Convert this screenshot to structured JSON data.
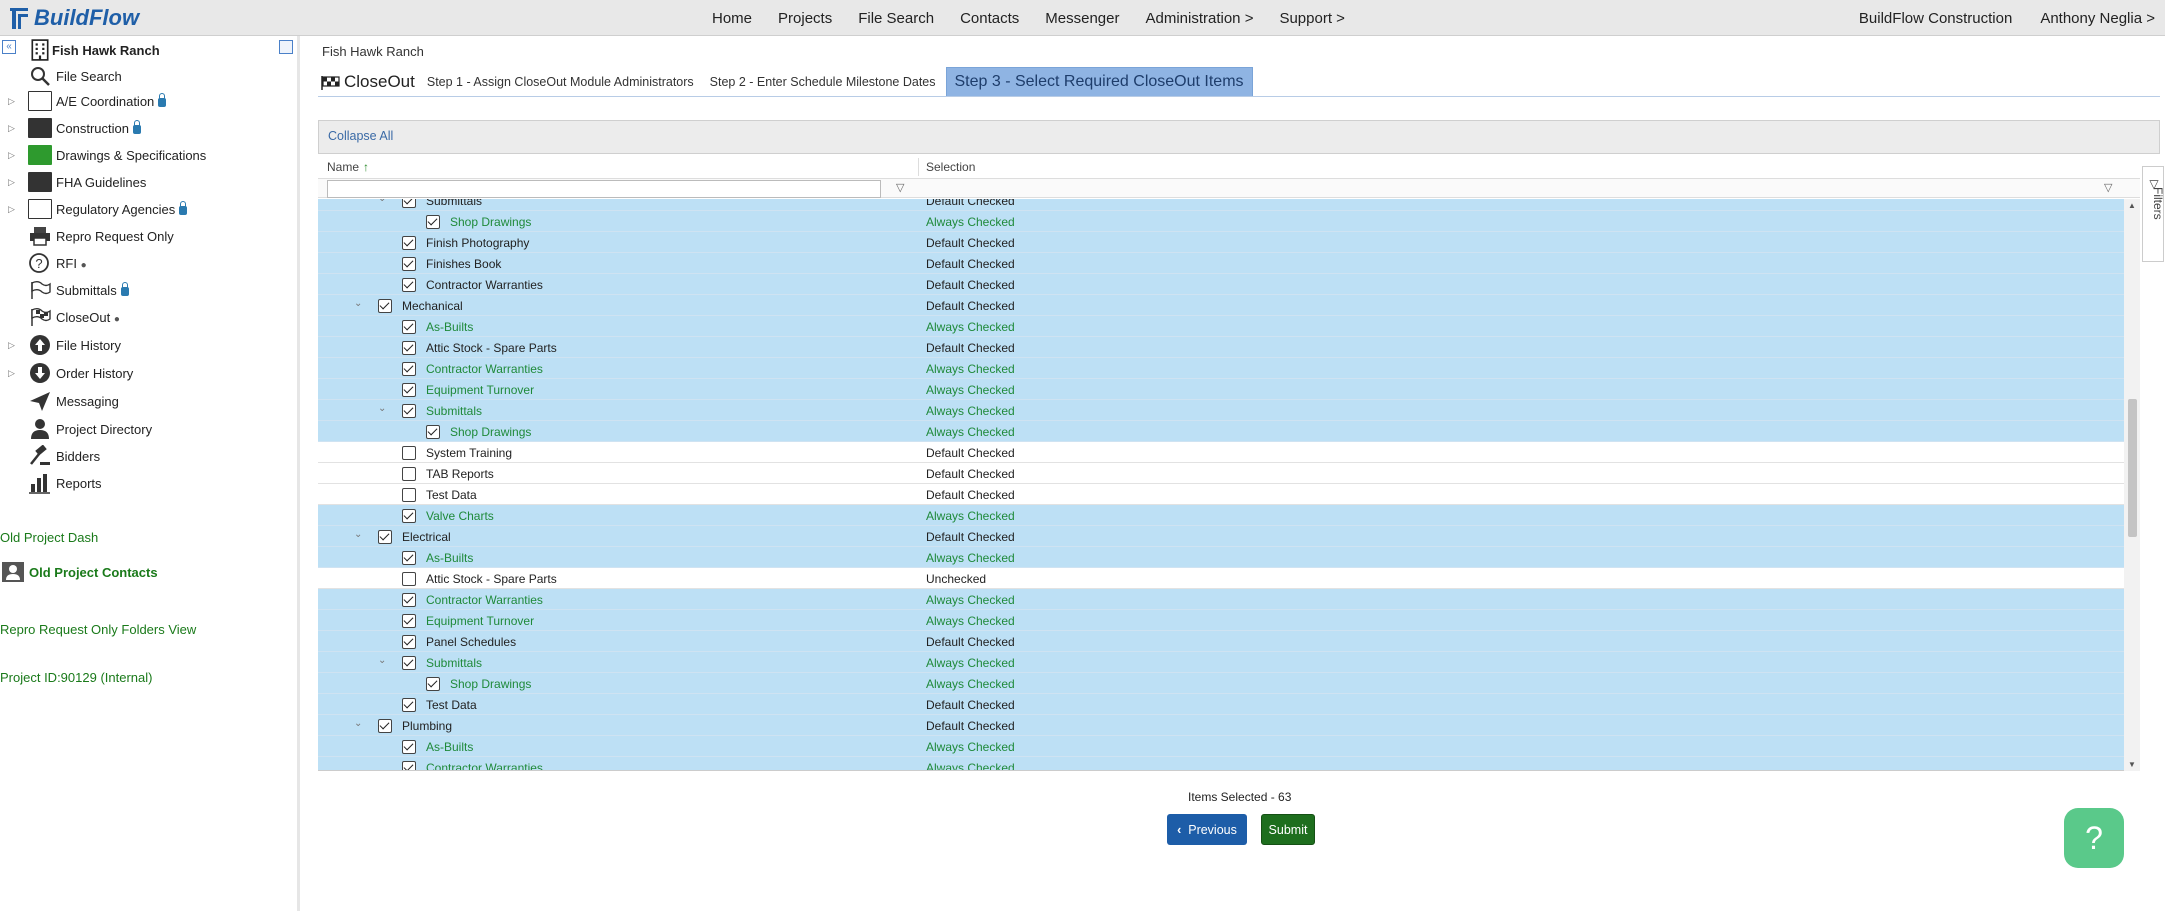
{
  "brand": {
    "name": "BuildFlow"
  },
  "nav": [
    "Home",
    "Projects",
    "File Search",
    "Contacts",
    "Messenger",
    "Administration >",
    "Support >"
  ],
  "user": {
    "company": "BuildFlow Construction",
    "name": "Anthony Neglia >"
  },
  "sidebar": {
    "project": "Fish Hawk Ranch",
    "items": [
      {
        "label": "File Search"
      },
      {
        "label": "A/E Coordination"
      },
      {
        "label": "Construction"
      },
      {
        "label": "Drawings & Specifications"
      },
      {
        "label": "FHA Guidelines"
      },
      {
        "label": "Regulatory Agencies"
      },
      {
        "label": "Repro Request Only"
      },
      {
        "label": "RFI"
      },
      {
        "label": "Submittals"
      },
      {
        "label": "CloseOut"
      },
      {
        "label": "File History"
      },
      {
        "label": "Order History"
      },
      {
        "label": "Messaging"
      },
      {
        "label": "Project Directory"
      },
      {
        "label": "Bidders"
      },
      {
        "label": "Reports"
      }
    ],
    "links": {
      "old_dash": "Old Project Dash",
      "old_contacts": "Old Project Contacts",
      "repro_view": "Repro Request Only Folders View",
      "project_id": "Project ID:90129 (Internal)"
    }
  },
  "main": {
    "breadcrumb": "Fish Hawk Ranch",
    "module_title": "CloseOut",
    "steps": [
      "Step 1 - Assign CloseOut Module Administrators",
      "Step 2 - Enter Schedule Milestone Dates",
      "Step 3 - Select Required CloseOut Items"
    ],
    "collapse_all": "Collapse All",
    "col_name": "Name",
    "col_selection": "Selection",
    "filters_tab": "Filters",
    "items_selected": "Items Selected - 63",
    "btn_previous": "Previous",
    "btn_submit": "Submit",
    "help": "?"
  },
  "rows": [
    {
      "name": "Submittals",
      "status": "Default Checked",
      "level": 2,
      "checked": true,
      "tw": true,
      "green": false,
      "partial": true
    },
    {
      "name": "Shop Drawings",
      "status": "Always Checked",
      "level": 3,
      "checked": true,
      "green": true
    },
    {
      "name": "Finish Photography",
      "status": "Default Checked",
      "level": 2,
      "checked": true,
      "green": false
    },
    {
      "name": "Finishes Book",
      "status": "Default Checked",
      "level": 2,
      "checked": true,
      "green": false
    },
    {
      "name": "Contractor Warranties",
      "status": "Default Checked",
      "level": 2,
      "checked": true,
      "green": false
    },
    {
      "name": "Mechanical",
      "status": "Default Checked",
      "level": 1,
      "checked": true,
      "tw": true,
      "green": false
    },
    {
      "name": "As-Builts",
      "status": "Always Checked",
      "level": 2,
      "checked": true,
      "green": true
    },
    {
      "name": "Attic Stock - Spare Parts",
      "status": "Default Checked",
      "level": 2,
      "checked": true,
      "green": false
    },
    {
      "name": "Contractor Warranties",
      "status": "Always Checked",
      "level": 2,
      "checked": true,
      "green": true
    },
    {
      "name": "Equipment Turnover",
      "status": "Always Checked",
      "level": 2,
      "checked": true,
      "green": true
    },
    {
      "name": "Submittals",
      "status": "Always Checked",
      "level": 2,
      "checked": true,
      "tw": true,
      "green": true
    },
    {
      "name": "Shop Drawings",
      "status": "Always Checked",
      "level": 3,
      "checked": true,
      "green": true
    },
    {
      "name": "System Training",
      "status": "Default Checked",
      "level": 2,
      "checked": false,
      "green": false
    },
    {
      "name": "TAB Reports",
      "status": "Default Checked",
      "level": 2,
      "checked": false,
      "green": false
    },
    {
      "name": "Test Data",
      "status": "Default Checked",
      "level": 2,
      "checked": false,
      "green": false
    },
    {
      "name": "Valve Charts",
      "status": "Always Checked",
      "level": 2,
      "checked": true,
      "green": true
    },
    {
      "name": "Electrical",
      "status": "Default Checked",
      "level": 1,
      "checked": true,
      "tw": true,
      "green": false
    },
    {
      "name": "As-Builts",
      "status": "Always Checked",
      "level": 2,
      "checked": true,
      "green": true
    },
    {
      "name": "Attic Stock - Spare Parts",
      "status": "Unchecked",
      "level": 2,
      "checked": false,
      "green": false
    },
    {
      "name": "Contractor Warranties",
      "status": "Always Checked",
      "level": 2,
      "checked": true,
      "green": true
    },
    {
      "name": "Equipment Turnover",
      "status": "Always Checked",
      "level": 2,
      "checked": true,
      "green": true
    },
    {
      "name": "Panel Schedules",
      "status": "Default Checked",
      "level": 2,
      "checked": true,
      "green": false
    },
    {
      "name": "Submittals",
      "status": "Always Checked",
      "level": 2,
      "checked": true,
      "tw": true,
      "green": true
    },
    {
      "name": "Shop Drawings",
      "status": "Always Checked",
      "level": 3,
      "checked": true,
      "green": true
    },
    {
      "name": "Test Data",
      "status": "Default Checked",
      "level": 2,
      "checked": true,
      "green": false
    },
    {
      "name": "Plumbing",
      "status": "Default Checked",
      "level": 1,
      "checked": true,
      "tw": true,
      "green": false
    },
    {
      "name": "As-Builts",
      "status": "Always Checked",
      "level": 2,
      "checked": true,
      "green": true
    },
    {
      "name": "Contractor Warranties",
      "status": "Always Checked",
      "level": 2,
      "checked": true,
      "green": true
    }
  ]
}
